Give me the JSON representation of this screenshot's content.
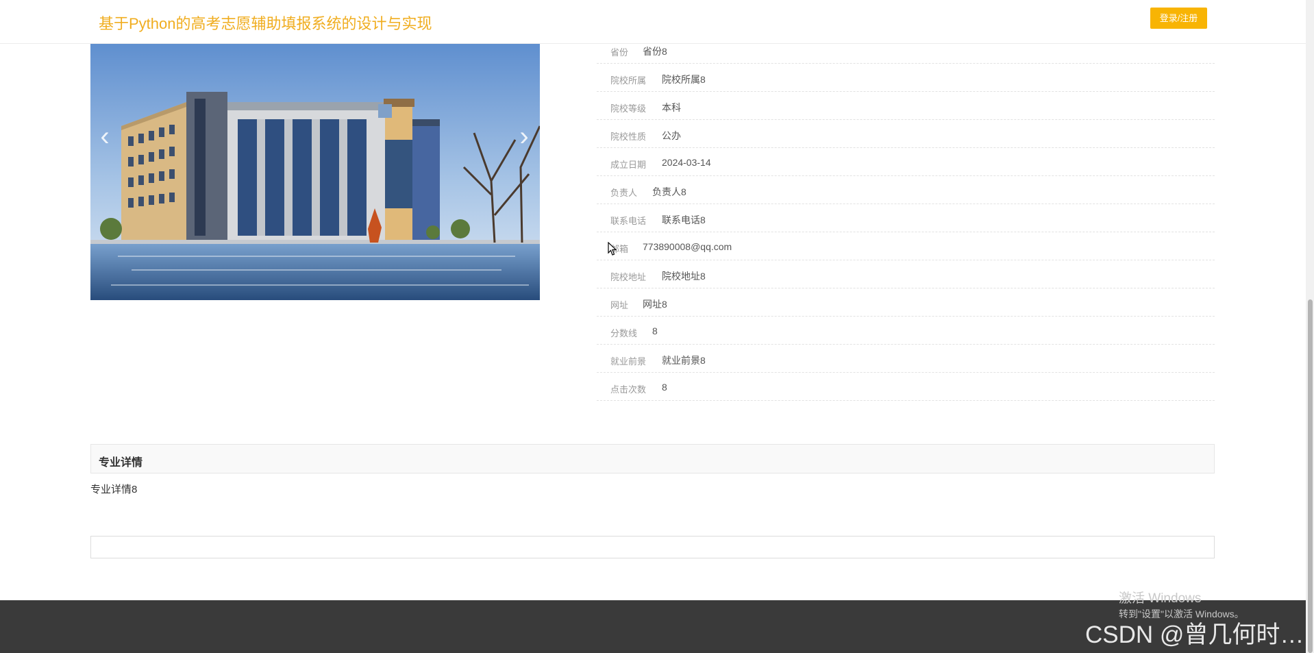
{
  "header": {
    "title": "基于Python的高考志愿辅助填报系统的设计与实现",
    "login_label": "登录/注册"
  },
  "carousel": {
    "prev_glyph": "‹",
    "next_glyph": "›"
  },
  "details": [
    {
      "label": "省份",
      "value": "省份8"
    },
    {
      "label": "院校所属",
      "value": "院校所属8"
    },
    {
      "label": "院校等级",
      "value": "本科"
    },
    {
      "label": "院校性质",
      "value": "公办"
    },
    {
      "label": "成立日期",
      "value": "2024-03-14"
    },
    {
      "label": "负责人",
      "value": "负责人8"
    },
    {
      "label": "联系电话",
      "value": "联系电话8"
    },
    {
      "label": "邮箱",
      "value": "773890008@qq.com"
    },
    {
      "label": "院校地址",
      "value": "院校地址8"
    },
    {
      "label": "网址",
      "value": "网址8"
    },
    {
      "label": "分数线",
      "value": "8"
    },
    {
      "label": "就业前景",
      "value": "就业前景8"
    },
    {
      "label": "点击次数",
      "value": "8"
    }
  ],
  "section": {
    "heading": "专业详情",
    "body": "专业详情8"
  },
  "overlay": {
    "activate_line1": "激活 Windows",
    "activate_line2": "转到\"设置\"以激活 Windows。",
    "csdn": "CSDN @曾几何时…"
  }
}
